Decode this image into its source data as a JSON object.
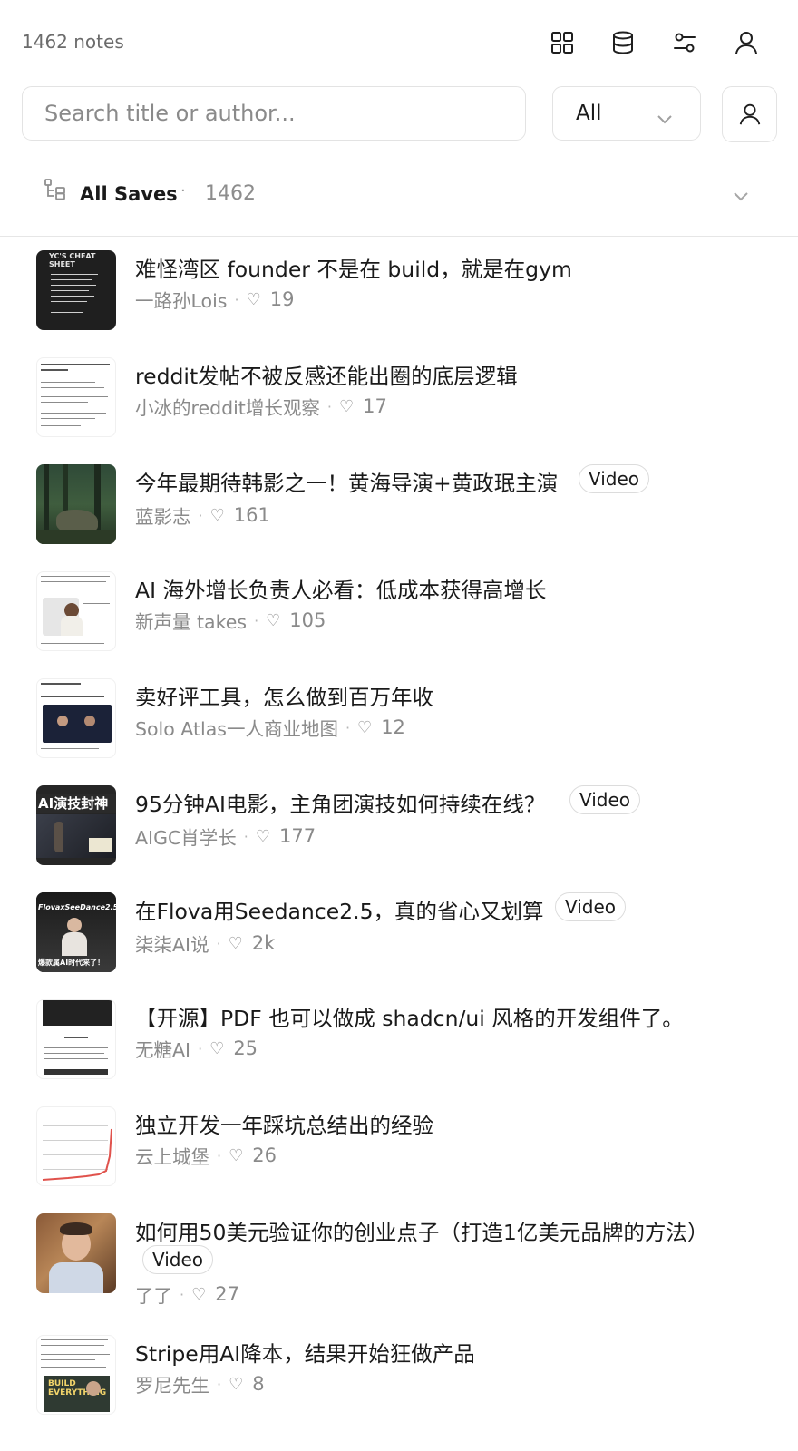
{
  "header": {
    "note_count": "1462 notes",
    "icons": [
      "grid-icon",
      "database-icon",
      "filter-sliders-icon",
      "user-icon"
    ]
  },
  "search": {
    "placeholder": "Search title or author...",
    "value": "",
    "filter_value": "All"
  },
  "collection": {
    "name": "All Saves",
    "separator": "·",
    "count": "1462"
  },
  "notes": [
    {
      "title": "难怪湾区 founder 不是在 build，就是在gym",
      "author": "一路孙Lois",
      "likes": "19",
      "video": ""
    },
    {
      "title": "reddit发帖不被反感还能出圈的底层逻辑",
      "author": "小冰的reddit增长观察",
      "likes": "17",
      "video": ""
    },
    {
      "title": "今年最期待韩影之一！黄海导演+黄政珉主演",
      "author": "蓝影志",
      "likes": "161",
      "video": "Video"
    },
    {
      "title": "AI 海外增长负责人必看：低成本获得高增长",
      "author": "新声量 takes",
      "likes": "105",
      "video": ""
    },
    {
      "title": "卖好评工具，怎么做到百万年收",
      "author": "Solo Atlas一人商业地图",
      "likes": "12",
      "video": ""
    },
    {
      "title": "95分钟AI电影，主角团演技如何持续在线？",
      "author": "AIGC肖学长",
      "likes": "177",
      "video": "Video"
    },
    {
      "title": "在Flova用Seedance2.5，真的省心又划算",
      "author": "柒柒AI说",
      "likes": "2k",
      "video": "Video"
    },
    {
      "title": "【开源】PDF 也可以做成 shadcn/ui 风格的开发组件了。",
      "author": "无糖AI",
      "likes": "25",
      "video": ""
    },
    {
      "title": "独立开发一年踩坑总结出的经验",
      "author": "云上城堡",
      "likes": "26",
      "video": ""
    },
    {
      "title": "如何用50美元验证你的创业点子（打造1亿美元品牌的方法）",
      "author": "了了",
      "likes": "27",
      "video": "Video"
    },
    {
      "title": "Stripe用AI降本，结果开始狂做产品",
      "author": "罗尼先生",
      "likes": "8",
      "video": ""
    }
  ],
  "thumb_text": {
    "t0": "YC'S CHEAT SHEET",
    "t5": "AI演技封神",
    "t6": "FlovaxSeeDance2.5",
    "t6b": "爆款属AI时代来了！",
    "t10": "BUILD EVERYTHING"
  },
  "meta_symbols": {
    "dot": "·",
    "heart": "♡"
  },
  "colors": {
    "text": "#1a1a1a",
    "muted": "#8a8a8a",
    "border": "#e3e3e3"
  }
}
